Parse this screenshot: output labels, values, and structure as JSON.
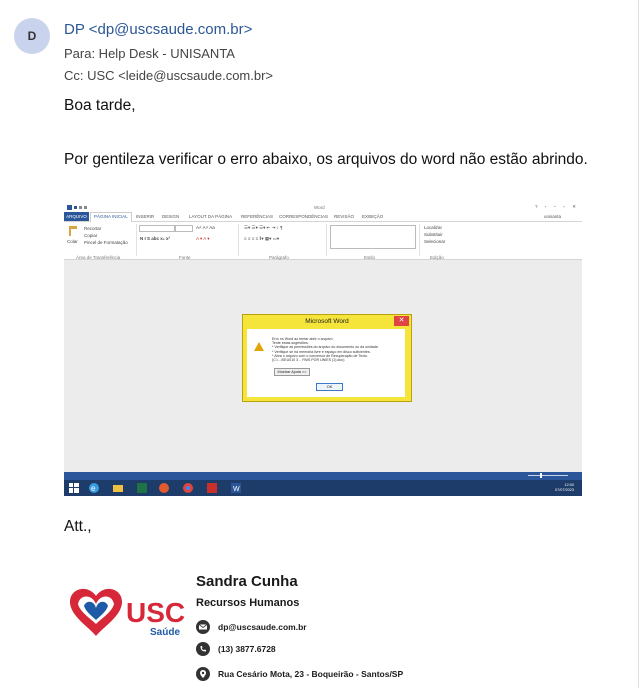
{
  "email": {
    "avatar_letter": "D",
    "from": "DP <dp@uscsaude.com.br>",
    "to": "Para:  Help Desk - UNISANTA",
    "cc": "Cc:  USC <leide@uscsaude.com.br>",
    "greeting": "Boa tarde,",
    "message": "Por gentileza verificar o erro abaixo,  os arquivos do word não estão abrindo.",
    "closing": "Att.,"
  },
  "screenshot": {
    "window_title": "Word",
    "user": "unisanta",
    "tabs": [
      "ARQUIVO",
      "PÁGINA INICIAL",
      "INSERIR",
      "DESIGN",
      "LAYOUT DA PÁGINA",
      "REFERÊNCIAS",
      "CORRESPONDÊNCIAS",
      "REVISÃO",
      "EXIBIÇÃO"
    ],
    "ribbon": {
      "paste": "Colar",
      "cut": "Recortar",
      "copy": "Copiar",
      "format_painter": "Pincel de Formatação",
      "groups": [
        "Área de Transferência",
        "Fonte",
        "Parágrafo",
        "Estilo",
        "Edição"
      ],
      "find": "Localizar",
      "replace": "Substituir",
      "select": "Selecionar"
    },
    "dialog": {
      "title": "Microsoft Word",
      "message": "Erro no Word ao tentar abrir o arquivo.\nTente estas sugestões.\n* Verifique as permissões do arquivo do documento ou da unidade.\n* Verifique se há memória livre e espaço em disco suficientes.\n* Abra o arquivo com o conversor de Recuperação de Texto.\n(C:\\...\\SEU010 3 -  PAIS POR UNIES (1).doc)",
      "help_button": "Mostrar Ajuda >>",
      "ok_button": "OK"
    },
    "clock": {
      "lang": "POR PTB2",
      "time": "12:00",
      "date": "07/07/2023"
    }
  },
  "signature": {
    "name": "Sandra Cunha",
    "role": "Recursos Humanos",
    "email": "dp@uscsaude.com.br",
    "phone": "(13) 3877.6728",
    "address": "Rua Cesário Mota, 23 - Boqueirão - Santos/SP",
    "logo_text": "USC",
    "logo_sub": "Saúde"
  },
  "colors": {
    "link": "#2b5797",
    "word_blue": "#2b579a",
    "logo_red": "#d62839",
    "logo_blue": "#1f5aa6"
  }
}
